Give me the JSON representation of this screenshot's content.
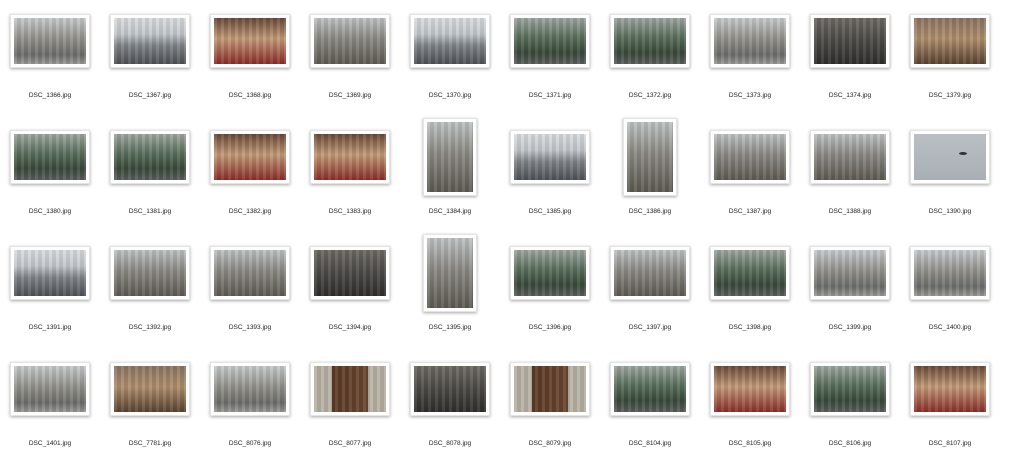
{
  "files": [
    {
      "name": "DSC_1366.jpg",
      "orientation": "landscape",
      "tone": "street"
    },
    {
      "name": "DSC_1367.jpg",
      "orientation": "landscape",
      "tone": "sky"
    },
    {
      "name": "DSC_1368.jpg",
      "orientation": "landscape",
      "tone": "shop"
    },
    {
      "name": "DSC_1369.jpg",
      "orientation": "landscape",
      "tone": "facade"
    },
    {
      "name": "DSC_1370.jpg",
      "orientation": "landscape",
      "tone": "sky"
    },
    {
      "name": "DSC_1371.jpg",
      "orientation": "landscape",
      "tone": "green"
    },
    {
      "name": "DSC_1372.jpg",
      "orientation": "landscape",
      "tone": "green"
    },
    {
      "name": "DSC_1373.jpg",
      "orientation": "landscape",
      "tone": "street"
    },
    {
      "name": "DSC_1374.jpg",
      "orientation": "landscape",
      "tone": "dark"
    },
    {
      "name": "DSC_1379.jpg",
      "orientation": "landscape",
      "tone": "warm"
    },
    {
      "name": "DSC_1380.jpg",
      "orientation": "landscape",
      "tone": "green"
    },
    {
      "name": "DSC_1381.jpg",
      "orientation": "landscape",
      "tone": "green"
    },
    {
      "name": "DSC_1382.jpg",
      "orientation": "landscape",
      "tone": "shop"
    },
    {
      "name": "DSC_1383.jpg",
      "orientation": "landscape",
      "tone": "shop"
    },
    {
      "name": "DSC_1384.jpg",
      "orientation": "portrait",
      "tone": "facade"
    },
    {
      "name": "DSC_1385.jpg",
      "orientation": "landscape",
      "tone": "sky"
    },
    {
      "name": "DSC_1386.jpg",
      "orientation": "portrait",
      "tone": "facade"
    },
    {
      "name": "DSC_1387.jpg",
      "orientation": "landscape",
      "tone": "facade"
    },
    {
      "name": "DSC_1388.jpg",
      "orientation": "landscape",
      "tone": "facade"
    },
    {
      "name": "DSC_1390.jpg",
      "orientation": "landscape",
      "tone": "grey"
    },
    {
      "name": "DSC_1391.jpg",
      "orientation": "landscape",
      "tone": "sky"
    },
    {
      "name": "DSC_1392.jpg",
      "orientation": "landscape",
      "tone": "facade"
    },
    {
      "name": "DSC_1393.jpg",
      "orientation": "landscape",
      "tone": "facade"
    },
    {
      "name": "DSC_1394.jpg",
      "orientation": "landscape",
      "tone": "dark"
    },
    {
      "name": "DSC_1395.jpg",
      "orientation": "portrait",
      "tone": "facade"
    },
    {
      "name": "DSC_1396.jpg",
      "orientation": "landscape",
      "tone": "green"
    },
    {
      "name": "DSC_1397.jpg",
      "orientation": "landscape",
      "tone": "facade"
    },
    {
      "name": "DSC_1398.jpg",
      "orientation": "landscape",
      "tone": "green"
    },
    {
      "name": "DSC_1399.jpg",
      "orientation": "landscape",
      "tone": "street"
    },
    {
      "name": "DSC_1400.jpg",
      "orientation": "landscape",
      "tone": "street"
    },
    {
      "name": "DSC_1401.jpg",
      "orientation": "landscape",
      "tone": "street"
    },
    {
      "name": "DSC_7781.jpg",
      "orientation": "landscape",
      "tone": "warm"
    },
    {
      "name": "DSC_8076.jpg",
      "orientation": "landscape",
      "tone": "street"
    },
    {
      "name": "DSC_8077.jpg",
      "orientation": "landscape",
      "tone": "door"
    },
    {
      "name": "DSC_8078.jpg",
      "orientation": "landscape",
      "tone": "dark"
    },
    {
      "name": "DSC_8079.jpg",
      "orientation": "landscape",
      "tone": "door"
    },
    {
      "name": "DSC_8104.jpg",
      "orientation": "landscape",
      "tone": "green"
    },
    {
      "name": "DSC_8105.jpg",
      "orientation": "landscape",
      "tone": "shop"
    },
    {
      "name": "DSC_8106.jpg",
      "orientation": "landscape",
      "tone": "green"
    },
    {
      "name": "DSC_8107.jpg",
      "orientation": "landscape",
      "tone": "shop"
    }
  ]
}
